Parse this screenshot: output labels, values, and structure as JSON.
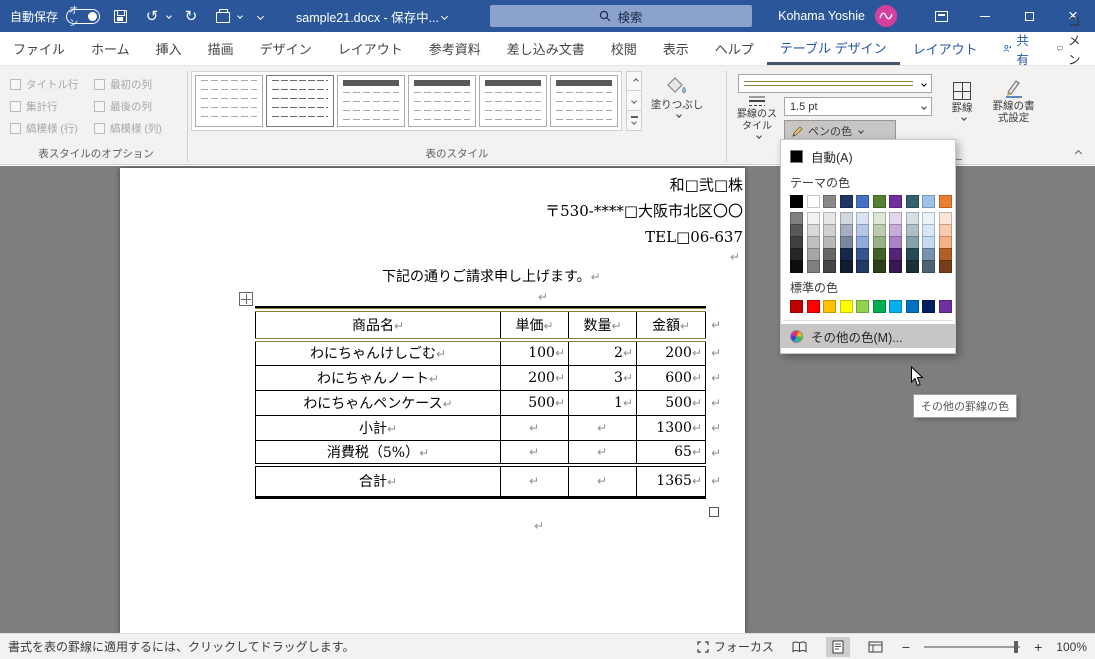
{
  "titlebar": {
    "autosave_label": "自動保存",
    "autosave_state": "オン",
    "doc_title": "sample21.docx - 保存中...",
    "search_placeholder": "検索",
    "user_name": "Kohama Yoshie"
  },
  "ribbon_tabs": {
    "file": "ファイル",
    "main": [
      "ホーム",
      "挿入",
      "描画",
      "デザイン",
      "レイアウト",
      "参考資料",
      "差し込み文書",
      "校閲",
      "表示",
      "ヘルプ"
    ],
    "contextual": [
      {
        "label": "テーブル デザイン",
        "active": true
      },
      {
        "label": "レイアウト",
        "active": false
      }
    ],
    "share": "共有",
    "comments": "コメント"
  },
  "ribbon": {
    "options_group": {
      "label": "表スタイルのオプション",
      "checkboxes": [
        "タイトル行",
        "集計行",
        "縞模様 (行)",
        "最初の列",
        "最後の列",
        "縞模様 (列)"
      ]
    },
    "styles_group": {
      "label": "表のスタイル",
      "thumbs": [
        "plain",
        "grid",
        "header",
        "header",
        "header",
        "header"
      ]
    },
    "shading": {
      "label": "塗りつぶし"
    },
    "borders_group": {
      "border_styles_label": "罫線のスタイル",
      "pen_weight": "1.5 pt",
      "pen_color_label": "ペンの色",
      "borders_label": "罫線",
      "painter_label": "罫線の書式設定",
      "pen_line_color": "#8f7f3f"
    }
  },
  "color_picker": {
    "automatic_label": "自動(A)",
    "theme_label": "テーマの色",
    "standard_label": "標準の色",
    "more_label": "その他の色(M)...",
    "tooltip": "その他の罫線の色",
    "theme_colors": [
      "#000000",
      "#FFFFFF",
      "#898989",
      "#1F3763",
      "#4472C4",
      "#548235",
      "#7030A0",
      "#33626F",
      "#9DC3E6",
      "#ED7D31"
    ],
    "standard_colors": [
      "#C00000",
      "#FF0000",
      "#FFC000",
      "#FFFF00",
      "#92D050",
      "#00B050",
      "#00B0F0",
      "#0070C0",
      "#002060",
      "#7030A0"
    ]
  },
  "document": {
    "return_mark": "↵",
    "header_lines": [
      "和□弐□株",
      "〒530-****□大阪市北区〇〇",
      "TEL□06-637"
    ],
    "greeting": "下記の通りご請求申し上げます。",
    "table": {
      "headers": [
        "商品名",
        "単価",
        "数量",
        "金額"
      ],
      "rows": [
        [
          "わにちゃんけしごむ",
          "100",
          "2",
          "200"
        ],
        [
          "わにちゃんノート",
          "200",
          "3",
          "600"
        ],
        [
          "わにちゃんペンケース",
          "500",
          "1",
          "500"
        ],
        [
          "小計",
          "",
          "",
          "1300"
        ],
        [
          "消費税（5%）",
          "",
          "",
          "65"
        ],
        [
          "合計",
          "",
          "",
          "1365"
        ]
      ],
      "border_accent": "#8f7f3f"
    }
  },
  "statusbar": {
    "message": "書式を表の罫線に適用するには、クリックしてドラッグします。",
    "focus_label": "フォーカス",
    "zoom_level": "100%"
  },
  "icons": {
    "undo": "↺",
    "redo": "↻",
    "close": "×"
  }
}
